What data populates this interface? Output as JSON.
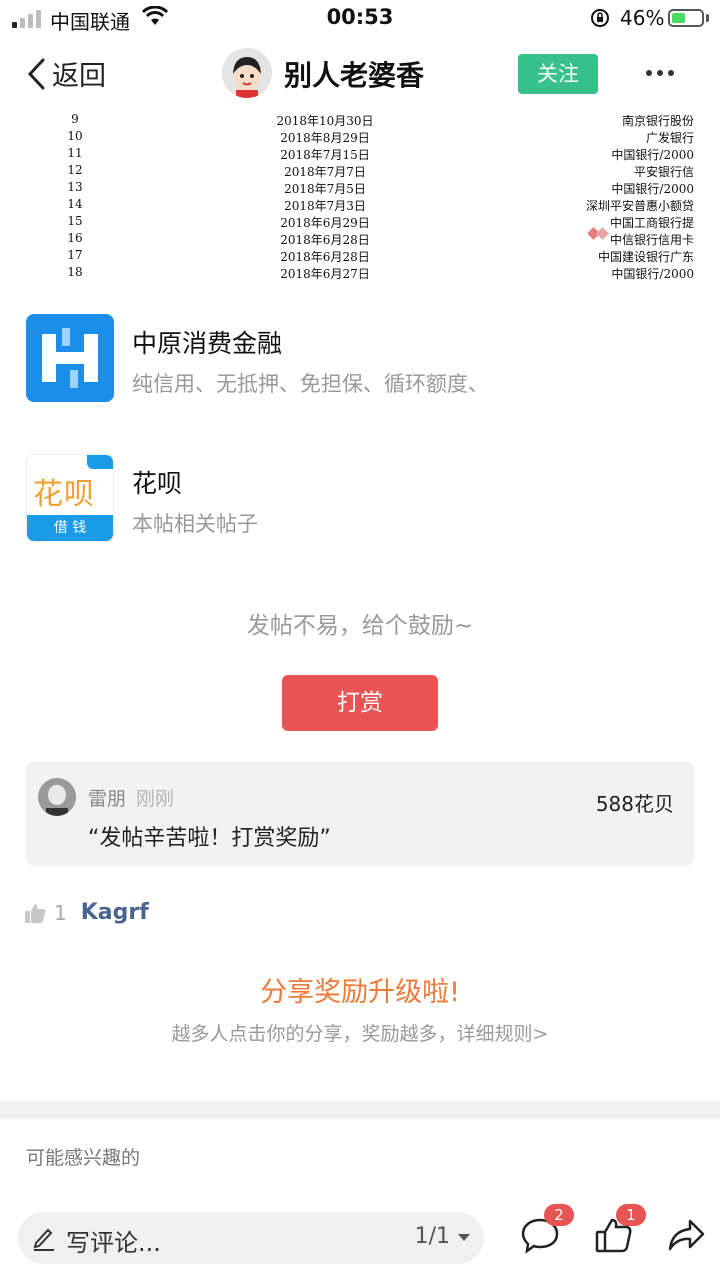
{
  "status_bar": {
    "carrier": "中国联通",
    "time": "00:53",
    "battery_pct": "46%",
    "battery_level": 0.46
  },
  "nav": {
    "back_label": "返回",
    "title": "别人老婆香",
    "follow_label": "关注"
  },
  "table_image": {
    "rows": [
      {
        "no": "9",
        "date": "2018年10月30日",
        "bank": "南京银行股份"
      },
      {
        "no": "10",
        "date": "2018年8月29日",
        "bank": "广发银行"
      },
      {
        "no": "11",
        "date": "2018年7月15日",
        "bank": "中国银行/2000"
      },
      {
        "no": "12",
        "date": "2018年7月7日",
        "bank": "平安银行信"
      },
      {
        "no": "13",
        "date": "2018年7月5日",
        "bank": "中国银行/2000"
      },
      {
        "no": "14",
        "date": "2018年7月3日",
        "bank": "深圳平安普惠小额贷"
      },
      {
        "no": "15",
        "date": "2018年6月29日",
        "bank": "中国工商银行提"
      },
      {
        "no": "16",
        "date": "2018年6月28日",
        "bank": "中信银行信用卡"
      },
      {
        "no": "17",
        "date": "2018年6月28日",
        "bank": "中国建设银行广东"
      },
      {
        "no": "18",
        "date": "2018年6月27日",
        "bank": "中国银行/2000"
      }
    ]
  },
  "cards": [
    {
      "title": "中原消费金融",
      "subtitle": "纯信用、无抵押、免担保、循环额度、"
    },
    {
      "title": "花呗",
      "subtitle": "本帖相关帖子",
      "logo_text": "花呗",
      "logo_sub": "借 钱"
    }
  ],
  "encourage_text": "发帖不易，给个鼓励~",
  "reward_button": "打赏",
  "reward_record": {
    "name": "雷朋",
    "time": "刚刚",
    "amount": "588花贝",
    "message": "“发帖辛苦啦！打赏奖励”"
  },
  "likes": {
    "count": "1",
    "user": "Kagrf"
  },
  "share": {
    "title": "分享奖励升级啦!",
    "subtitle": "越多人点击你的分享，奖励越多，详细规则>"
  },
  "maybe_interested": "可能感兴趣的",
  "bottom_bar": {
    "comment_placeholder": "写评论...",
    "page": "1/1",
    "comment_badge": "2",
    "like_badge": "1"
  },
  "colors": {
    "follow": "#38c08a",
    "reward": "#e85353",
    "share": "#ee7a3a",
    "link_user": "#4a6490"
  }
}
